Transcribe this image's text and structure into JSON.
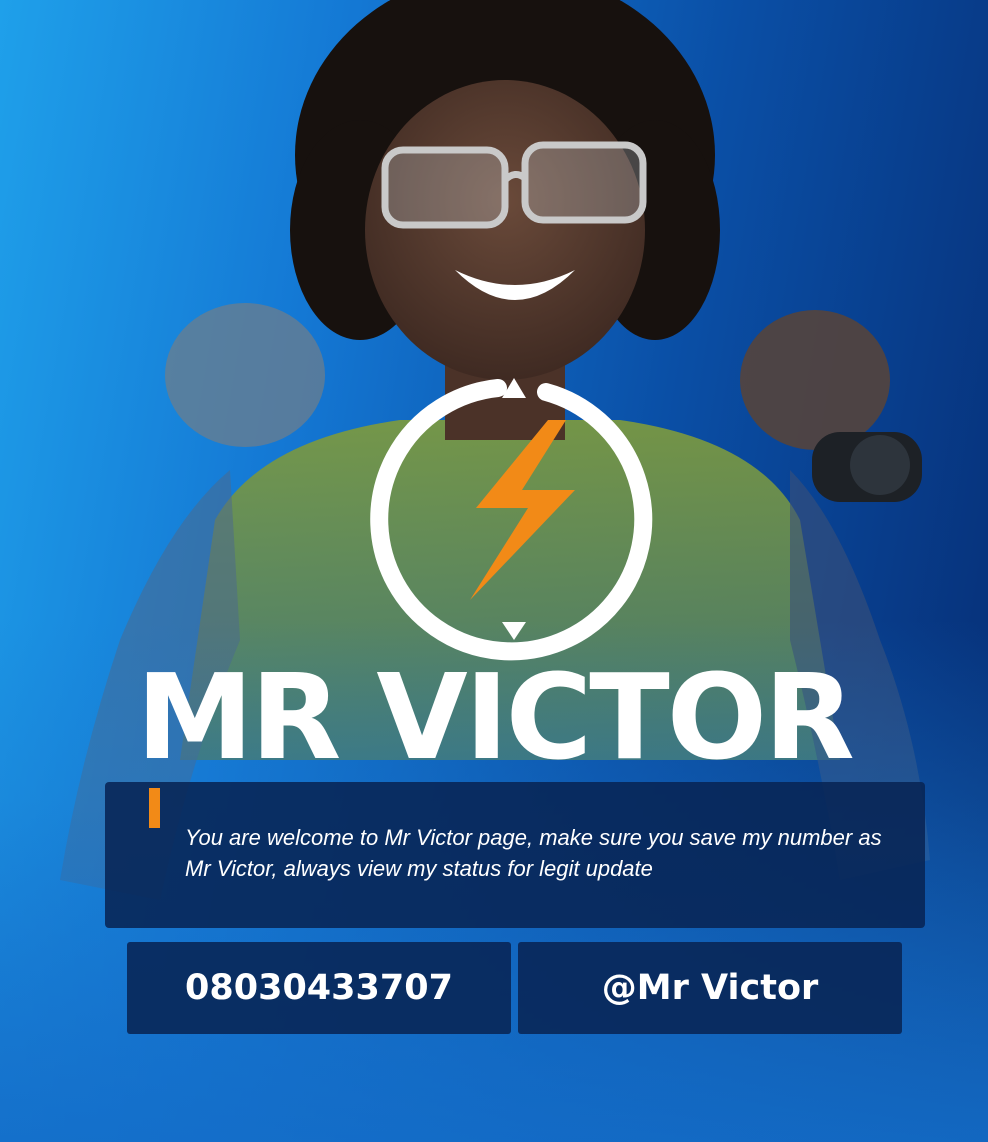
{
  "brand": {
    "title": "MR VICTOR"
  },
  "message": {
    "text": "You are welcome to Mr Victor page, make sure you save my number as Mr Victor, always view my status for legit update"
  },
  "contacts": {
    "phone": "08030433707",
    "handle": "@Mr Victor"
  },
  "colors": {
    "accent": "#f28a17",
    "panel": "#082454",
    "background_light": "#1fa0ea",
    "background_dark": "#062c72"
  },
  "icons": [
    "lightning-bolt-icon",
    "circle-ring-logo"
  ]
}
